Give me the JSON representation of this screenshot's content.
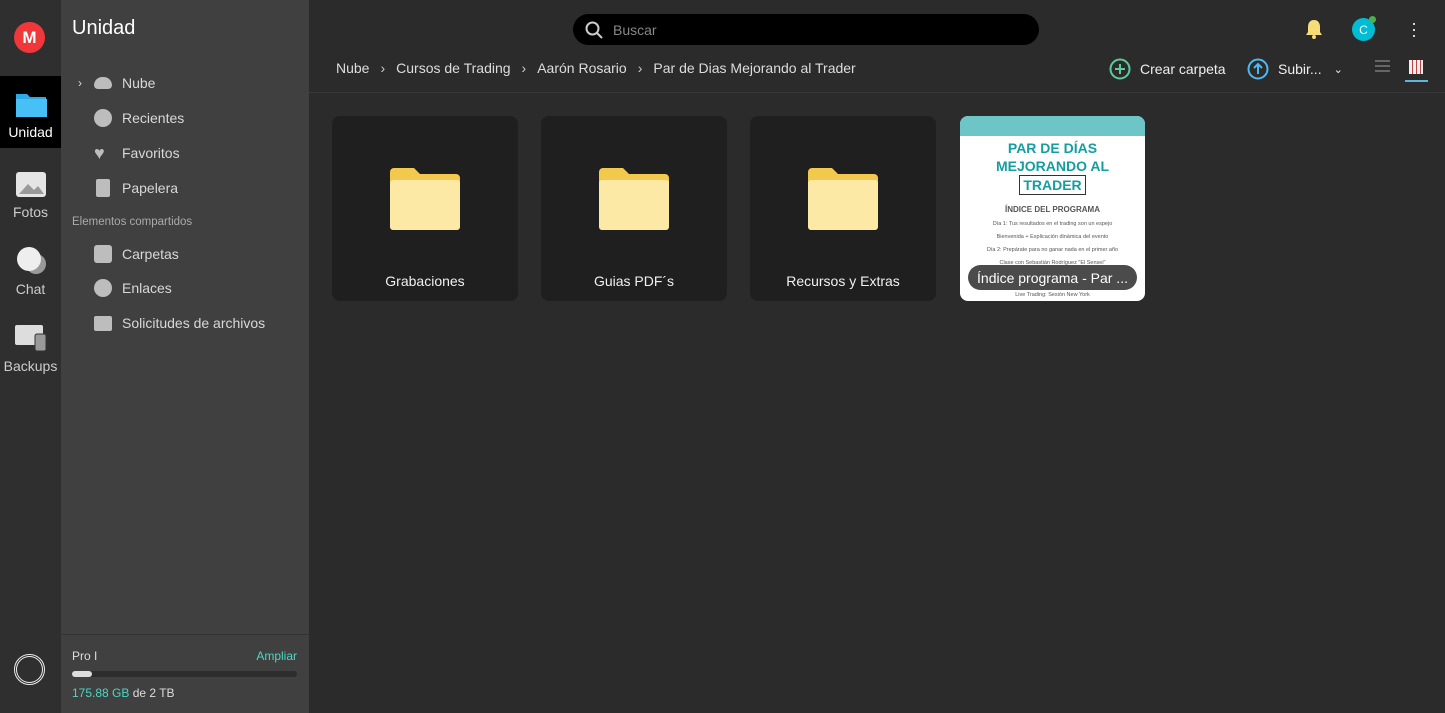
{
  "rail": {
    "logo": "M",
    "items": [
      {
        "label": "Unidad",
        "icon": "folder-icon",
        "active": true
      },
      {
        "label": "Fotos",
        "icon": "photos-icon"
      },
      {
        "label": "Chat",
        "icon": "chat-icon"
      },
      {
        "label": "Backups",
        "icon": "backups-icon"
      }
    ]
  },
  "sidebar": {
    "title": "Unidad",
    "items": [
      {
        "label": "Nube",
        "icon": "cloud-icon"
      },
      {
        "label": "Recientes",
        "icon": "clock-icon"
      },
      {
        "label": "Favoritos",
        "icon": "heart-icon"
      },
      {
        "label": "Papelera",
        "icon": "trash-icon"
      }
    ],
    "shared_title": "Elementos compartidos",
    "shared": [
      {
        "label": "Carpetas",
        "icon": "shared-folder-icon"
      },
      {
        "label": "Enlaces",
        "icon": "link-icon"
      },
      {
        "label": "Solicitudes de archivos",
        "icon": "file-request-icon"
      }
    ],
    "storage": {
      "plan": "Pro I",
      "upgrade": "Ampliar",
      "used": "175.88 GB",
      "total": "de 2 TB",
      "used_percent": 8.8
    }
  },
  "header": {
    "search_placeholder": "Buscar"
  },
  "breadcrumb": [
    "Nube",
    "Cursos de Trading",
    "Aarón Rosario",
    "Par de Dias Mejorando al Trader"
  ],
  "actions": {
    "create_folder": "Crear carpeta",
    "upload": "Subir...",
    "view": "grid"
  },
  "colors": {
    "accent": "#4ad7c4",
    "mega_red": "#f0373a",
    "folder": "#fde9a6",
    "avatar": "#00bcd4"
  },
  "avatar": {
    "letter": "C"
  },
  "items": [
    {
      "type": "folder",
      "name": "Grabaciones"
    },
    {
      "type": "folder",
      "name": "Guias PDF´s"
    },
    {
      "type": "folder",
      "name": "Recursos y Extras"
    },
    {
      "type": "file",
      "name": "Índice programa - Par ...",
      "thumb": {
        "l1": "PAR DE DÍAS",
        "l2": "MEJORANDO AL",
        "l3": "TRADER",
        "index": "ÍNDICE DEL PROGRAMA",
        "lines": [
          "Día 1: Tus resultados en el trading son un espejo",
          "Bienvenida + Explicación dinámica del evento",
          "Día 2: Prepárate para no ganar nada en el primer año",
          "Clase con Sebastián Rodríguez \"El Sensei\"",
          "Live Trading: Sesión New York"
        ]
      }
    }
  ]
}
